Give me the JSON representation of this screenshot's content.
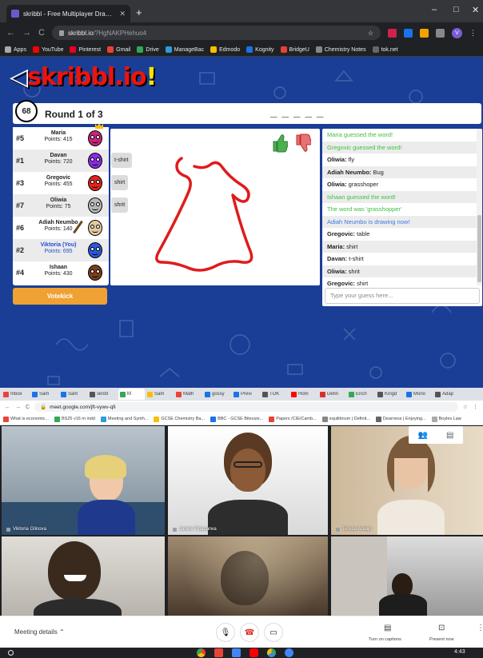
{
  "browser_top": {
    "tab_title": "skribbl - Free Multiplayer Drawing",
    "url_host": "skribbl.io",
    "url_path": "/?HgNAKPHehuo4",
    "bookmarks": [
      "Apps",
      "YouTube",
      "Pinterest",
      "Gmail",
      "Drive",
      "ManageBac",
      "Edmodo",
      "Kognity",
      "BridgeU",
      "Chemistry Notes",
      "tok.net"
    ],
    "profile_initial": "V"
  },
  "game": {
    "logo_text": "skribbl.io",
    "logo_suffix": "!",
    "timer": "68",
    "round_text": "Round 1 of 3",
    "word_hint": "_ _ _ _ _",
    "players": [
      {
        "rank": "#5",
        "name": "Maria",
        "points": "Points: 415",
        "color": "#c6257a",
        "you": false
      },
      {
        "rank": "#1",
        "name": "Davan",
        "points": "Points: 720",
        "color": "#8a2be2",
        "you": false
      },
      {
        "rank": "#3",
        "name": "Gregovic",
        "points": "Points: 455",
        "color": "#e0241b",
        "you": false
      },
      {
        "rank": "#7",
        "name": "Oliwia",
        "points": "Points: 75",
        "color": "#b8b8b8",
        "you": false
      },
      {
        "rank": "#6",
        "name": "Adiah Neumbo",
        "points": "Points: 140",
        "color": "#e6c9a0",
        "you": false
      },
      {
        "rank": "#2",
        "name": "Viktoria (You)",
        "points": "Points: 695",
        "color": "#2a58d6",
        "you": true
      },
      {
        "rank": "#4",
        "name": "Ishaan",
        "points": "Points: 430",
        "color": "#7a3e1c",
        "you": false
      }
    ],
    "bubbles": [
      "t-shirt",
      "shirt",
      "shrit"
    ],
    "votekick_label": "Votekick",
    "chat": [
      {
        "kind": "g",
        "name": "",
        "text": "Maria guessed the word!"
      },
      {
        "kind": "g",
        "name": "",
        "text": "Gregovic guessed the word!"
      },
      {
        "kind": "n",
        "name": "Oliwia:",
        "text": " fly"
      },
      {
        "kind": "n",
        "name": "Adiah Neumbo:",
        "text": " Bug"
      },
      {
        "kind": "n",
        "name": "Oliwia:",
        "text": " grasshoper"
      },
      {
        "kind": "g",
        "name": "",
        "text": "Ishaan guessed the word!"
      },
      {
        "kind": "g",
        "name": "",
        "text": "The word was 'grasshopper'"
      },
      {
        "kind": "b",
        "name": "",
        "text": "Adiah Neumbo is drawing now!"
      },
      {
        "kind": "n",
        "name": "Gregovic:",
        "text": " table"
      },
      {
        "kind": "n",
        "name": "Maria:",
        "text": " shirt"
      },
      {
        "kind": "n",
        "name": "Davan:",
        "text": " t-shirt"
      },
      {
        "kind": "n",
        "name": "Oliwia:",
        "text": " shrit"
      },
      {
        "kind": "n",
        "name": "Gregovic:",
        "text": " shirt"
      }
    ],
    "chat_placeholder": "Type your guess here..."
  },
  "browser_bottom": {
    "tabs": [
      "Inbox",
      "Sam",
      "Sam",
      "skribl",
      "M",
      "Sam",
      "Math",
      "gossy",
      "Previ",
      "TOK",
      "Hom",
      "Defin",
      "Ench",
      "Kingd",
      "Mono",
      "Adap"
    ],
    "url": "meet.google.com/jft-vywv-qfi",
    "bookmarks": [
      "What is economic...",
      "BS25 v16 m indd",
      "Meeting and Synth...",
      "GCSE Chemistry Ba...",
      "BBC - GCSE Bitesize...",
      "Papers /CIE/Camb...",
      "equilibrium | Definit...",
      "Dearness | Enjoying...",
      "Boyles Law"
    ]
  },
  "meet": {
    "participants": [
      {
        "name": "Viktoria Glinova"
      },
      {
        "name": "Janine Tibazarwa"
      },
      {
        "name": "Teresa Araujo"
      },
      {
        "name": ""
      },
      {
        "name": ""
      },
      {
        "name": ""
      }
    ],
    "meeting_details_label": "Meeting details",
    "captions_label": "Turn on captions",
    "present_label": "Present now"
  },
  "shelf": {
    "time": "4:43"
  }
}
